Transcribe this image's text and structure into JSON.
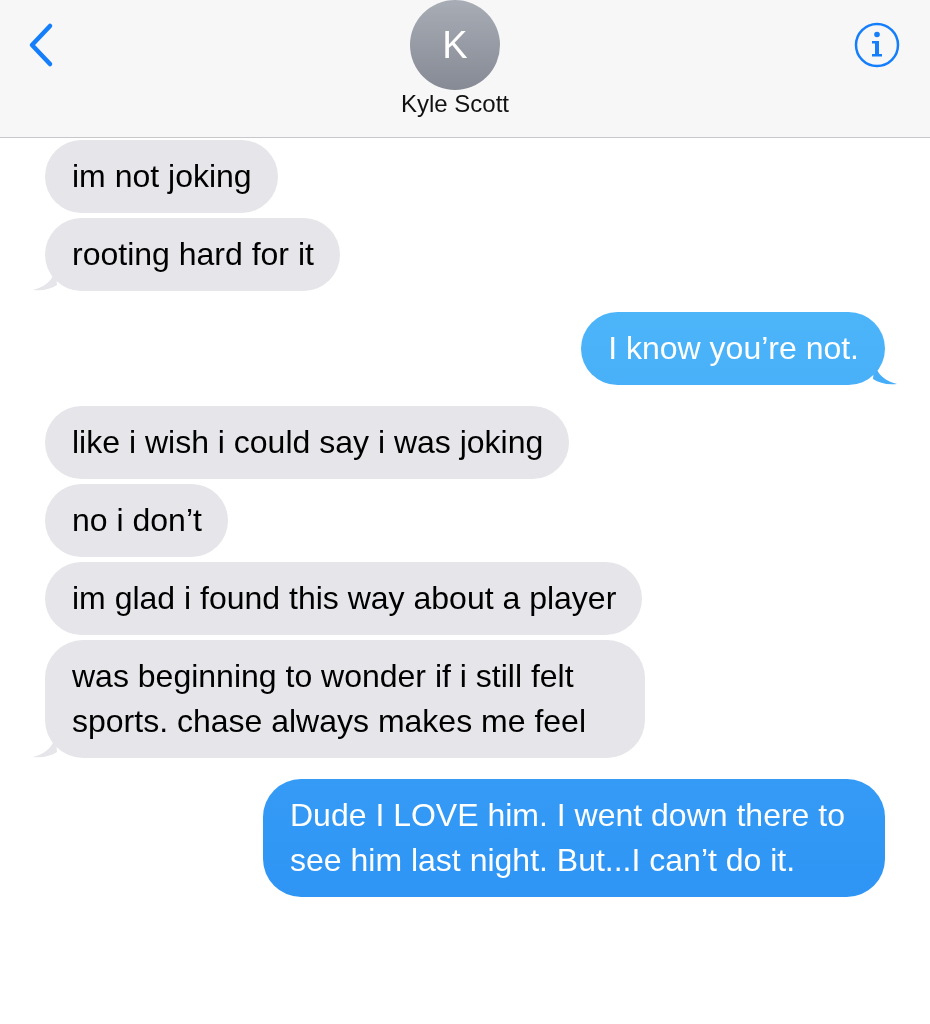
{
  "header": {
    "contact": {
      "initial": "K",
      "name": "Kyle Scott"
    }
  },
  "messages": [
    {
      "kind": "received",
      "text": "im not joking",
      "tail": false
    },
    {
      "kind": "received",
      "text": "rooting hard for it",
      "tail": true
    },
    {
      "kind": "sent",
      "text": "I know you’re not.",
      "tail": true
    },
    {
      "kind": "received",
      "text": "like i wish i could say i was joking",
      "tail": false
    },
    {
      "kind": "received",
      "text": "no i don’t",
      "tail": false
    },
    {
      "kind": "received",
      "text": "im glad i found this way about a player",
      "tail": false
    },
    {
      "kind": "received",
      "text": "was beginning to wonder if i still felt sports. chase always makes me feel",
      "tail": true
    },
    {
      "kind": "sent",
      "text": "Dude I LOVE him. I went down there to see him last night. But...I can’t do it.",
      "tail": false
    }
  ]
}
